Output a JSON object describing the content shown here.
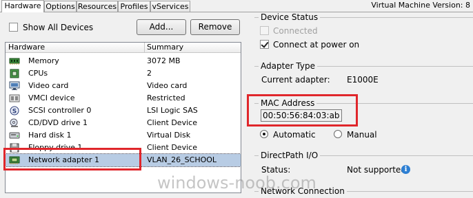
{
  "tabs": [
    {
      "label": "Hardware",
      "active": true
    },
    {
      "label": "Options"
    },
    {
      "label": "Resources"
    },
    {
      "label": "Profiles"
    },
    {
      "label": "vServices"
    }
  ],
  "vm_version": "Virtual Machine Version: 8",
  "left": {
    "show_all_devices_label": "Show All Devices",
    "add_label": "Add...",
    "remove_label": "Remove",
    "columns": {
      "hardware": "Hardware",
      "summary": "Summary"
    },
    "rows": [
      {
        "icon": "memory-icon",
        "name": "Memory",
        "summary": "3072 MB"
      },
      {
        "icon": "cpu-icon",
        "name": "CPUs",
        "summary": "2"
      },
      {
        "icon": "video-card-icon",
        "name": "Video card",
        "summary": "Video card"
      },
      {
        "icon": "vmci-icon",
        "name": "VMCI device",
        "summary": "Restricted"
      },
      {
        "icon": "scsi-icon",
        "name": "SCSI controller 0",
        "summary": "LSI Logic SAS"
      },
      {
        "icon": "cd-dvd-icon",
        "name": "CD/DVD drive 1",
        "summary": "Client Device"
      },
      {
        "icon": "hard-disk-icon",
        "name": "Hard disk 1",
        "summary": "Virtual Disk"
      },
      {
        "icon": "floppy-icon",
        "name": "Floppy drive 1",
        "summary": "Client Device"
      },
      {
        "icon": "network-adapter-icon",
        "name": "Network adapter 1",
        "summary": "VLAN_26_SCHOOL",
        "selected": true
      }
    ]
  },
  "right": {
    "device_status": {
      "title": "Device Status",
      "connected_label": "Connected",
      "connected_checked": false,
      "connect_power_on_label": "Connect at power on",
      "connect_power_on_checked": true
    },
    "adapter_type": {
      "title": "Adapter Type",
      "current_label": "Current adapter:",
      "current_value": "E1000E"
    },
    "mac_address": {
      "title": "MAC Address",
      "value": "00:50:56:84:03:ab",
      "automatic_label": "Automatic",
      "manual_label": "Manual",
      "selected": "Automatic"
    },
    "directpath": {
      "title": "DirectPath I/O",
      "status_label": "Status:",
      "status_value": "Not supported"
    },
    "network_connection": {
      "title": "Network Connection"
    }
  },
  "watermark": "windows-noob.com",
  "colors": {
    "highlight_red": "#e0262b",
    "selection": "#b8cce4",
    "info_blue": "#2d7fd3"
  }
}
